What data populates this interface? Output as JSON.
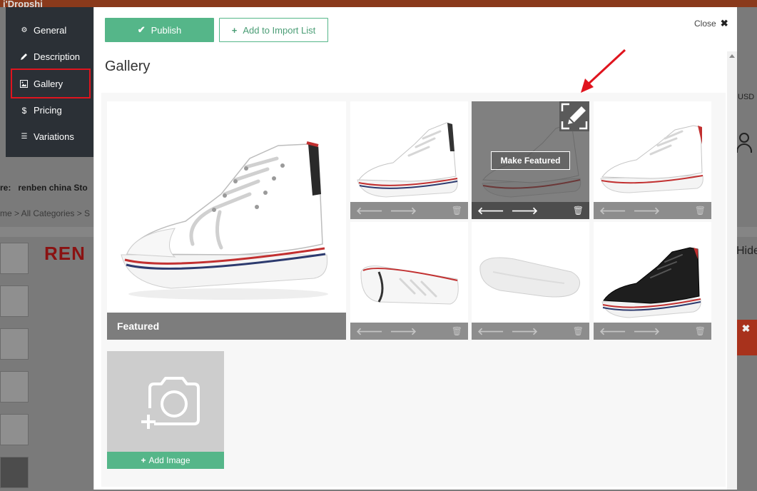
{
  "background": {
    "logo_text": "i'Dropshi",
    "store_label": "re:",
    "store_name": "renben china Sto",
    "breadcrumb": "me  >  All Categories  >  S",
    "brand_text": "REN",
    "right_usd": "USD",
    "right_hide": "Hide",
    "right_close": "✖"
  },
  "nav": {
    "items": [
      {
        "label": "General",
        "icon": "gear-icon"
      },
      {
        "label": "Description",
        "icon": "pencil-icon"
      },
      {
        "label": "Gallery",
        "icon": "image-icon"
      },
      {
        "label": "Pricing",
        "icon": "dollar-icon"
      },
      {
        "label": "Variations",
        "icon": "list-icon"
      }
    ],
    "highlighted": "Gallery"
  },
  "modal": {
    "publish_label": "Publish",
    "import_label": "Add to Import List",
    "close_label": "Close",
    "title": "Gallery",
    "featured_caption": "Featured",
    "make_featured_label": "Make Featured",
    "add_image_label": "Add Image"
  },
  "colors": {
    "accent_green": "#55b689",
    "nav_bg": "#2b3036",
    "highlight_red": "#e0141e"
  }
}
